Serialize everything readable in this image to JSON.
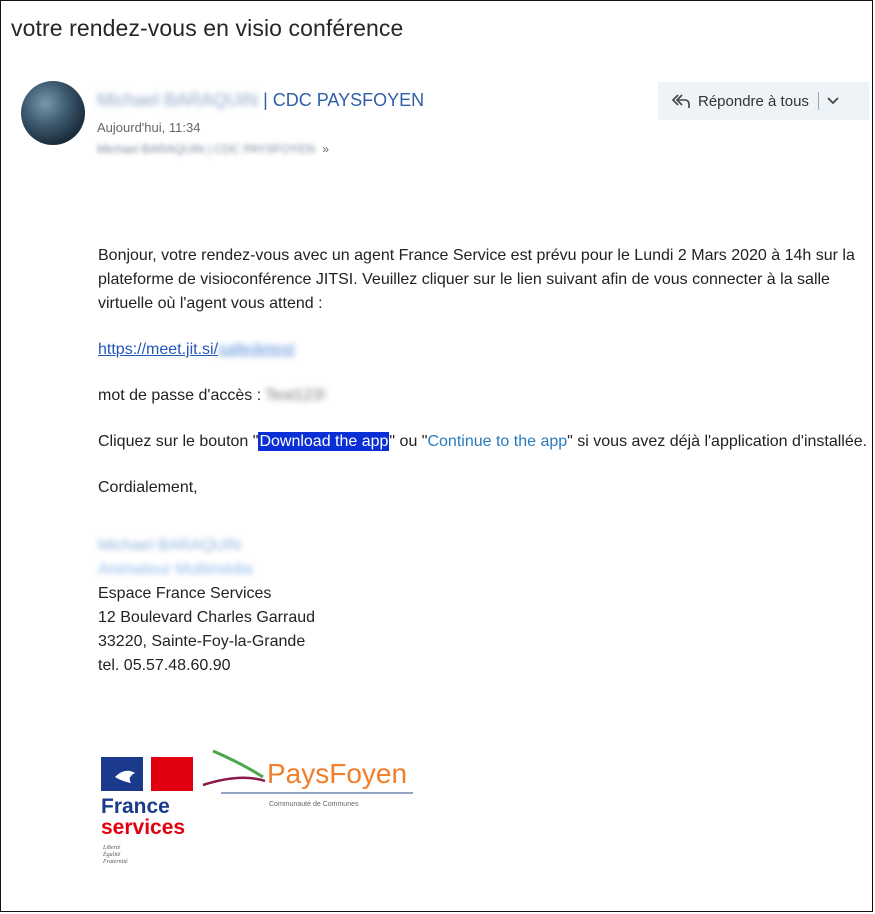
{
  "email": {
    "subject": "votre rendez-vous en visio conférence",
    "sender_name": "Michael BARAQUIN",
    "sender_org": "| CDC PAYSFOYEN",
    "time": "Aujourd'hui, 11:34",
    "recipients": "Michael BARAQUIN | CDC PAYSFOYEN",
    "recipients_chevron": "»",
    "reply_all_label": "Répondre à tous"
  },
  "body": {
    "intro": "Bonjour, votre rendez-vous avec un agent France Service est prévu pour le Lundi 2 Mars 2020 à 14h sur la plateforme de visioconférence JITSI. Veuillez cliquer sur le lien suivant afin de vous connecter à la salle virtuelle où l'agent vous attend :",
    "link_base": "https://meet.jit.si/",
    "link_room": "salledetest",
    "password_label": "mot de passe d'accès :",
    "password_value": "Test123!",
    "instruction_pre": "Cliquez sur le bouton \"",
    "instruction_download": "Download the app",
    "instruction_mid": "\" ou \"",
    "instruction_continue": "Continue to the app",
    "instruction_post": "\" si vous avez déjà l'application d'installée.",
    "closing": "Cordialement,"
  },
  "signature": {
    "name": "Michael BARAQUIN",
    "role": "Animateur Multimédia",
    "office": "Espace France Services",
    "street": "12 Boulevard Charles Garraud",
    "city": "33220, Sainte-Foy-la-Grande",
    "phone": "tel. 05.57.48.60.90"
  },
  "logos": {
    "france_services_line1": "France",
    "france_services_line2": "services",
    "motto1": "Liberté",
    "motto2": "Égalité",
    "motto3": "Fraternité",
    "paysfoyen_name": "PaysFoyen",
    "paysfoyen_sub": "Communauté de Communes"
  },
  "colors": {
    "link": "#2458b5",
    "highlight": "#0a2fd6",
    "france_blue": "#1b3a8c",
    "marianne_red": "#e1000f",
    "paysfoyen_orange": "#f07e2a",
    "paysfoyen_green": "#4aa84a"
  }
}
